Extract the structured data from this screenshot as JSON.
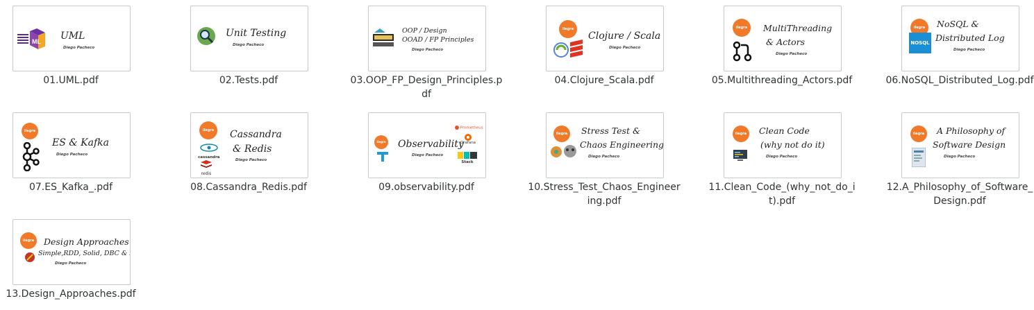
{
  "files": [
    {
      "name": "01.UML.pdf",
      "title": [
        "UML"
      ],
      "author": "Diego Pacheco",
      "icons": [
        "uml-icon"
      ],
      "badge": ""
    },
    {
      "name": "02.Tests.pdf",
      "title": [
        "Unit Testing"
      ],
      "author": "Diego Pacheco",
      "icons": [
        "magnifier-icon"
      ],
      "badge": ""
    },
    {
      "name": "03.OOP_FP_Design_Principles.pdf",
      "title": [
        "OOP / Design",
        "OOAD / FP Principles"
      ],
      "author": "Diego Pacheco",
      "icons": [
        "design-icon"
      ],
      "badge": ""
    },
    {
      "name": "04.Clojure_Scala.pdf",
      "title": [
        "Clojure / Scala"
      ],
      "author": "Diego Pacheco",
      "icons": [
        "clojure-icon",
        "scala-icon"
      ],
      "badge": "ilegra"
    },
    {
      "name": "05.Multithreading_Actors.pdf",
      "title": [
        "MultiThreading",
        "& Actors"
      ],
      "author": "Diego Pacheco",
      "icons": [
        "git-merge-icon"
      ],
      "badge": "ilegra"
    },
    {
      "name": "06.NoSQL_Distributed_Log.pdf",
      "title": [
        "NoSQL &",
        "Distributed Log"
      ],
      "author": "Diego Pacheco",
      "icons": [
        "nosql-icon"
      ],
      "badge": "ilegra",
      "icon_text": "NOSQL"
    },
    {
      "name": "07.ES_Kafka_.pdf",
      "title": [
        "ES & Kafka"
      ],
      "author": "Diego Pacheco",
      "icons": [
        "kafka-icon"
      ],
      "badge": "ilegra"
    },
    {
      "name": "08.Cassandra_Redis.pdf",
      "title": [
        "Cassandra",
        "& Redis"
      ],
      "author": "Diego Pacheco",
      "icons": [
        "cassandra-icon",
        "redis-icon"
      ],
      "badge": "ilegra",
      "icon_text": [
        "cassandra",
        "redis"
      ]
    },
    {
      "name": "09.observability.pdf",
      "title": [
        "Observability"
      ],
      "author": "Diego Pacheco",
      "icons": [
        "prometheus-icon",
        "grafana-icon",
        "elk-icon",
        "jaeger-icon"
      ],
      "badge": "ilegra",
      "icon_text": [
        "Prometheus",
        "Grafana",
        "Stack"
      ]
    },
    {
      "name": "10.Stress_Test_Chaos_Engineering.pdf",
      "title": [
        "Stress Test &",
        "Chaos Engineering"
      ],
      "author": "Diego Pacheco",
      "icons": [
        "chaos-icon"
      ],
      "badge": "ilegra"
    },
    {
      "name": "11.Clean_Code_(why_not_do_it).pdf",
      "title": [
        "Clean Code",
        "(why not do it)"
      ],
      "author": "Diego Pacheco",
      "icons": [
        "monitor-icon"
      ],
      "badge": "ilegra"
    },
    {
      "name": "12.A_Philosophy_of_Software_Design.pdf",
      "title": [
        "A Philosophy of",
        "Software Design"
      ],
      "author": "Diego Pacheco",
      "icons": [
        "book-cover-icon"
      ],
      "badge": "ilegra"
    },
    {
      "name": "13.Design_Approaches.pdf",
      "title": [
        "Design Approaches",
        "Simple,RDD, Solid, DBC & KISS"
      ],
      "author": "Diego Pacheco",
      "icons": [
        "design-approaches-icon"
      ],
      "badge": "ilegra"
    }
  ],
  "colors": {
    "label": "#2e3436",
    "border": "#c9c9c9",
    "ilegra": "#f07a2a"
  }
}
